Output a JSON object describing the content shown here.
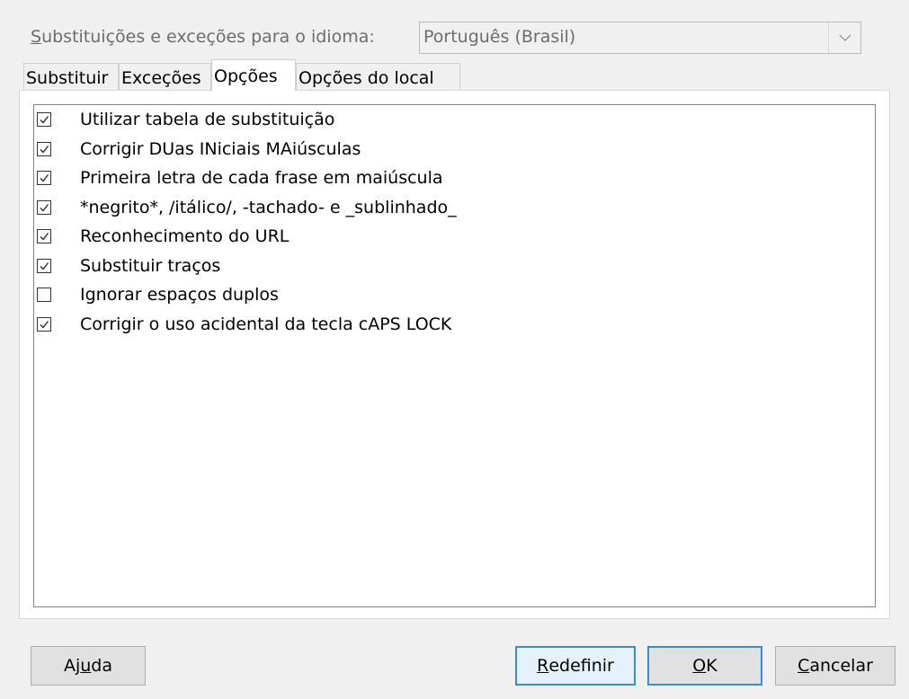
{
  "language": {
    "label_prefix": "S",
    "label_rest": "ubstituições e exceções para o idioma:",
    "selected": "Português (Brasil)",
    "dropdown_icon": "chevron-down-icon"
  },
  "tabs": [
    {
      "label": "Substituir",
      "active": false
    },
    {
      "label": "Exceções",
      "active": false
    },
    {
      "label": "Opções",
      "active": true
    },
    {
      "label": "Opções do local",
      "active": false
    }
  ],
  "options": [
    {
      "label": "Utilizar tabela de substituição",
      "checked": true
    },
    {
      "label": "Corrigir DUas INiciais MAiúsculas",
      "checked": true
    },
    {
      "label": "Primeira letra de cada frase em maiúscula",
      "checked": true
    },
    {
      "label": "*negrito*, /itálico/, -tachado- e _sublinhado_",
      "checked": true
    },
    {
      "label": "Reconhecimento do URL",
      "checked": true
    },
    {
      "label": "Substituir traços",
      "checked": true
    },
    {
      "label": "Ignorar espaços duplos",
      "checked": false
    },
    {
      "label": "Corrigir o uso acidental da tecla cAPS LOCK",
      "checked": true
    }
  ],
  "buttons": {
    "help_a": "Aj",
    "help_u": "u",
    "help_b": "da",
    "reset_u": "R",
    "reset_rest": "edefinir",
    "ok_u": "O",
    "ok_rest": "K",
    "cancel_u": "C",
    "cancel_rest": "ancelar"
  },
  "colors": {
    "accent": "#3c8bd9",
    "disabled_text": "#6d6d6d"
  }
}
